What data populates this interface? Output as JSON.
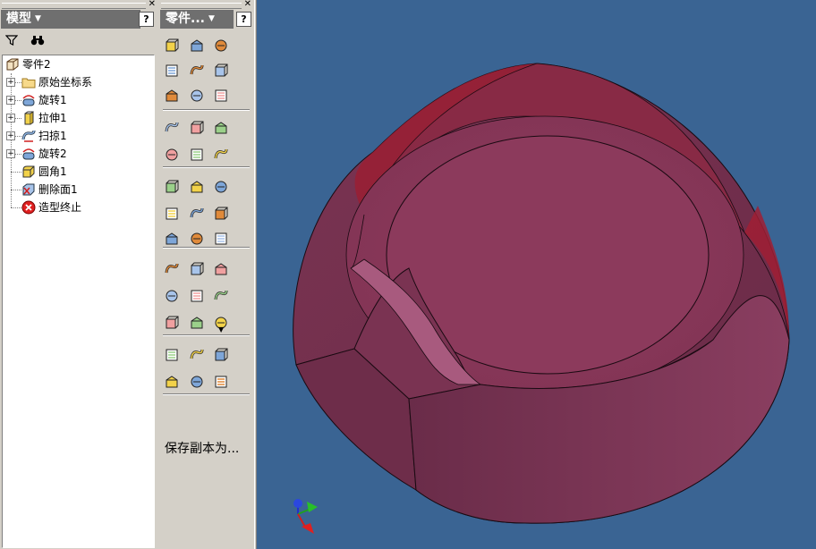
{
  "model_panel": {
    "title": "模型",
    "tree": [
      {
        "label": "零件2",
        "icon": "part-icon",
        "expandable": false
      },
      {
        "label": "原始坐标系",
        "icon": "folder-icon",
        "expandable": true
      },
      {
        "label": "旋转1",
        "icon": "revolve-icon",
        "expandable": true
      },
      {
        "label": "拉伸1",
        "icon": "extrude-icon",
        "expandable": true
      },
      {
        "label": "扫掠1",
        "icon": "sweep-icon",
        "expandable": true
      },
      {
        "label": "旋转2",
        "icon": "revolve-icon",
        "expandable": true
      },
      {
        "label": "圆角1",
        "icon": "fillet-icon",
        "expandable": false
      },
      {
        "label": "删除面1",
        "icon": "delete-face-icon",
        "expandable": false
      },
      {
        "label": "造型终止",
        "icon": "end-of-part-icon",
        "expandable": false
      }
    ]
  },
  "parts_panel": {
    "title": "零件...",
    "save_copy_label": "保存副本为...",
    "tools": [
      "revolve-icon",
      "hole-icon",
      "extrude-icon",
      "shell-icon",
      "rib-icon",
      "loft-icon",
      "sweep-icon",
      "coil-icon",
      "thread-icon",
      "split-icon",
      "face-draft-icon",
      "chamfer-icon",
      "emboss-icon",
      "decal-icon",
      "fillet-icon",
      "delete-face-icon",
      "derived-part-icon",
      "mirror-icon",
      "sheet-metal-icon",
      "replace-face-icon",
      "feature-pattern-icon",
      "work-plane-icon",
      "work-axis-icon",
      "work-point-icon",
      "grounded-icon",
      "rectangular-pattern-icon",
      "circular-pattern-icon",
      "ruler-icon",
      "point-icon",
      "parameters-icon",
      "derived-component-icon",
      "copy-object-icon",
      "info-icon",
      "ilogic-icon",
      "appearance-icon",
      "promote-icon",
      "sculpt-icon",
      "repair-icon",
      "material-icon"
    ]
  },
  "viewport": {
    "background": "#3a6493",
    "model_color": "#8e3a5a"
  }
}
